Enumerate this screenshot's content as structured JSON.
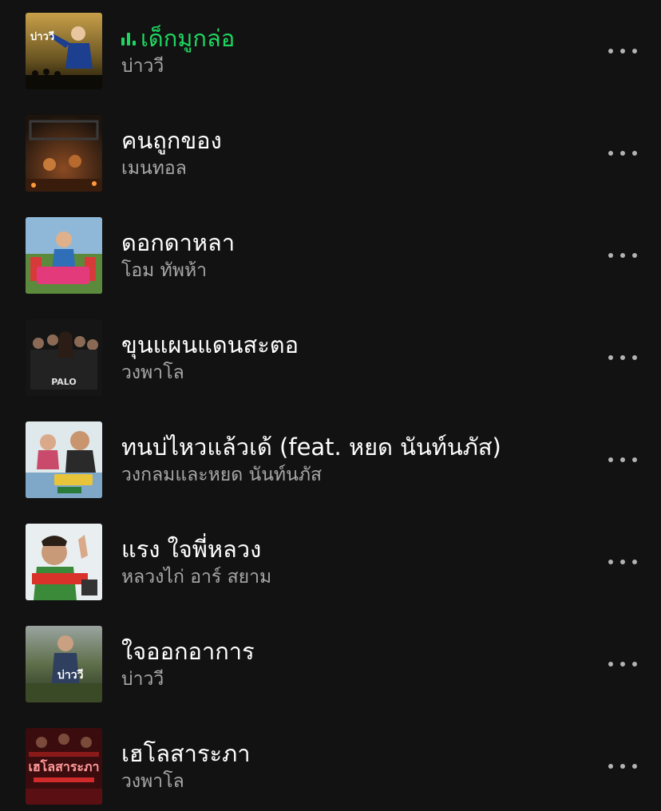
{
  "tracks": [
    {
      "title": "เด็กมูกล่อ",
      "artist": "บ่าววี",
      "playing": true,
      "cover_icon": "album-cover-bao-wee"
    },
    {
      "title": "คนถูกของ",
      "artist": "เมนทอล",
      "playing": false,
      "cover_icon": "album-cover-mental"
    },
    {
      "title": "ดอกดาหลา",
      "artist": "โอม ทัพห้า",
      "playing": false,
      "cover_icon": "album-cover-dok-dala"
    },
    {
      "title": "ขุนแผนแดนสะตอ",
      "artist": "วงพาโล",
      "playing": false,
      "cover_icon": "album-cover-palo"
    },
    {
      "title": "ทนบ่ไหวแล้วเด้ (feat. หยด นันท์นภัส)",
      "artist": "วงกลมและหยด นันท์นภัส",
      "playing": false,
      "cover_icon": "album-cover-ton-bor-wai"
    },
    {
      "title": "แรง ใจพี่หลวง",
      "artist": "หลวงไก่ อาร์ สยาม",
      "playing": false,
      "cover_icon": "album-cover-luang-kai"
    },
    {
      "title": "ใจออกอาการ",
      "artist": "บ่าววี",
      "playing": false,
      "cover_icon": "album-cover-bao-wee-2"
    },
    {
      "title": "เฮโลสาระภา",
      "artist": "วงพาโล",
      "playing": false,
      "cover_icon": "album-cover-helo"
    }
  ],
  "colors": {
    "background": "#121212",
    "playing_accent": "#1ed760",
    "title_text": "#ffffff",
    "artist_text": "#a7a7a7",
    "more_dots": "#b3b3b3"
  },
  "icons": {
    "now_playing": "equalizer-bars-icon",
    "more": "more-options-icon"
  }
}
